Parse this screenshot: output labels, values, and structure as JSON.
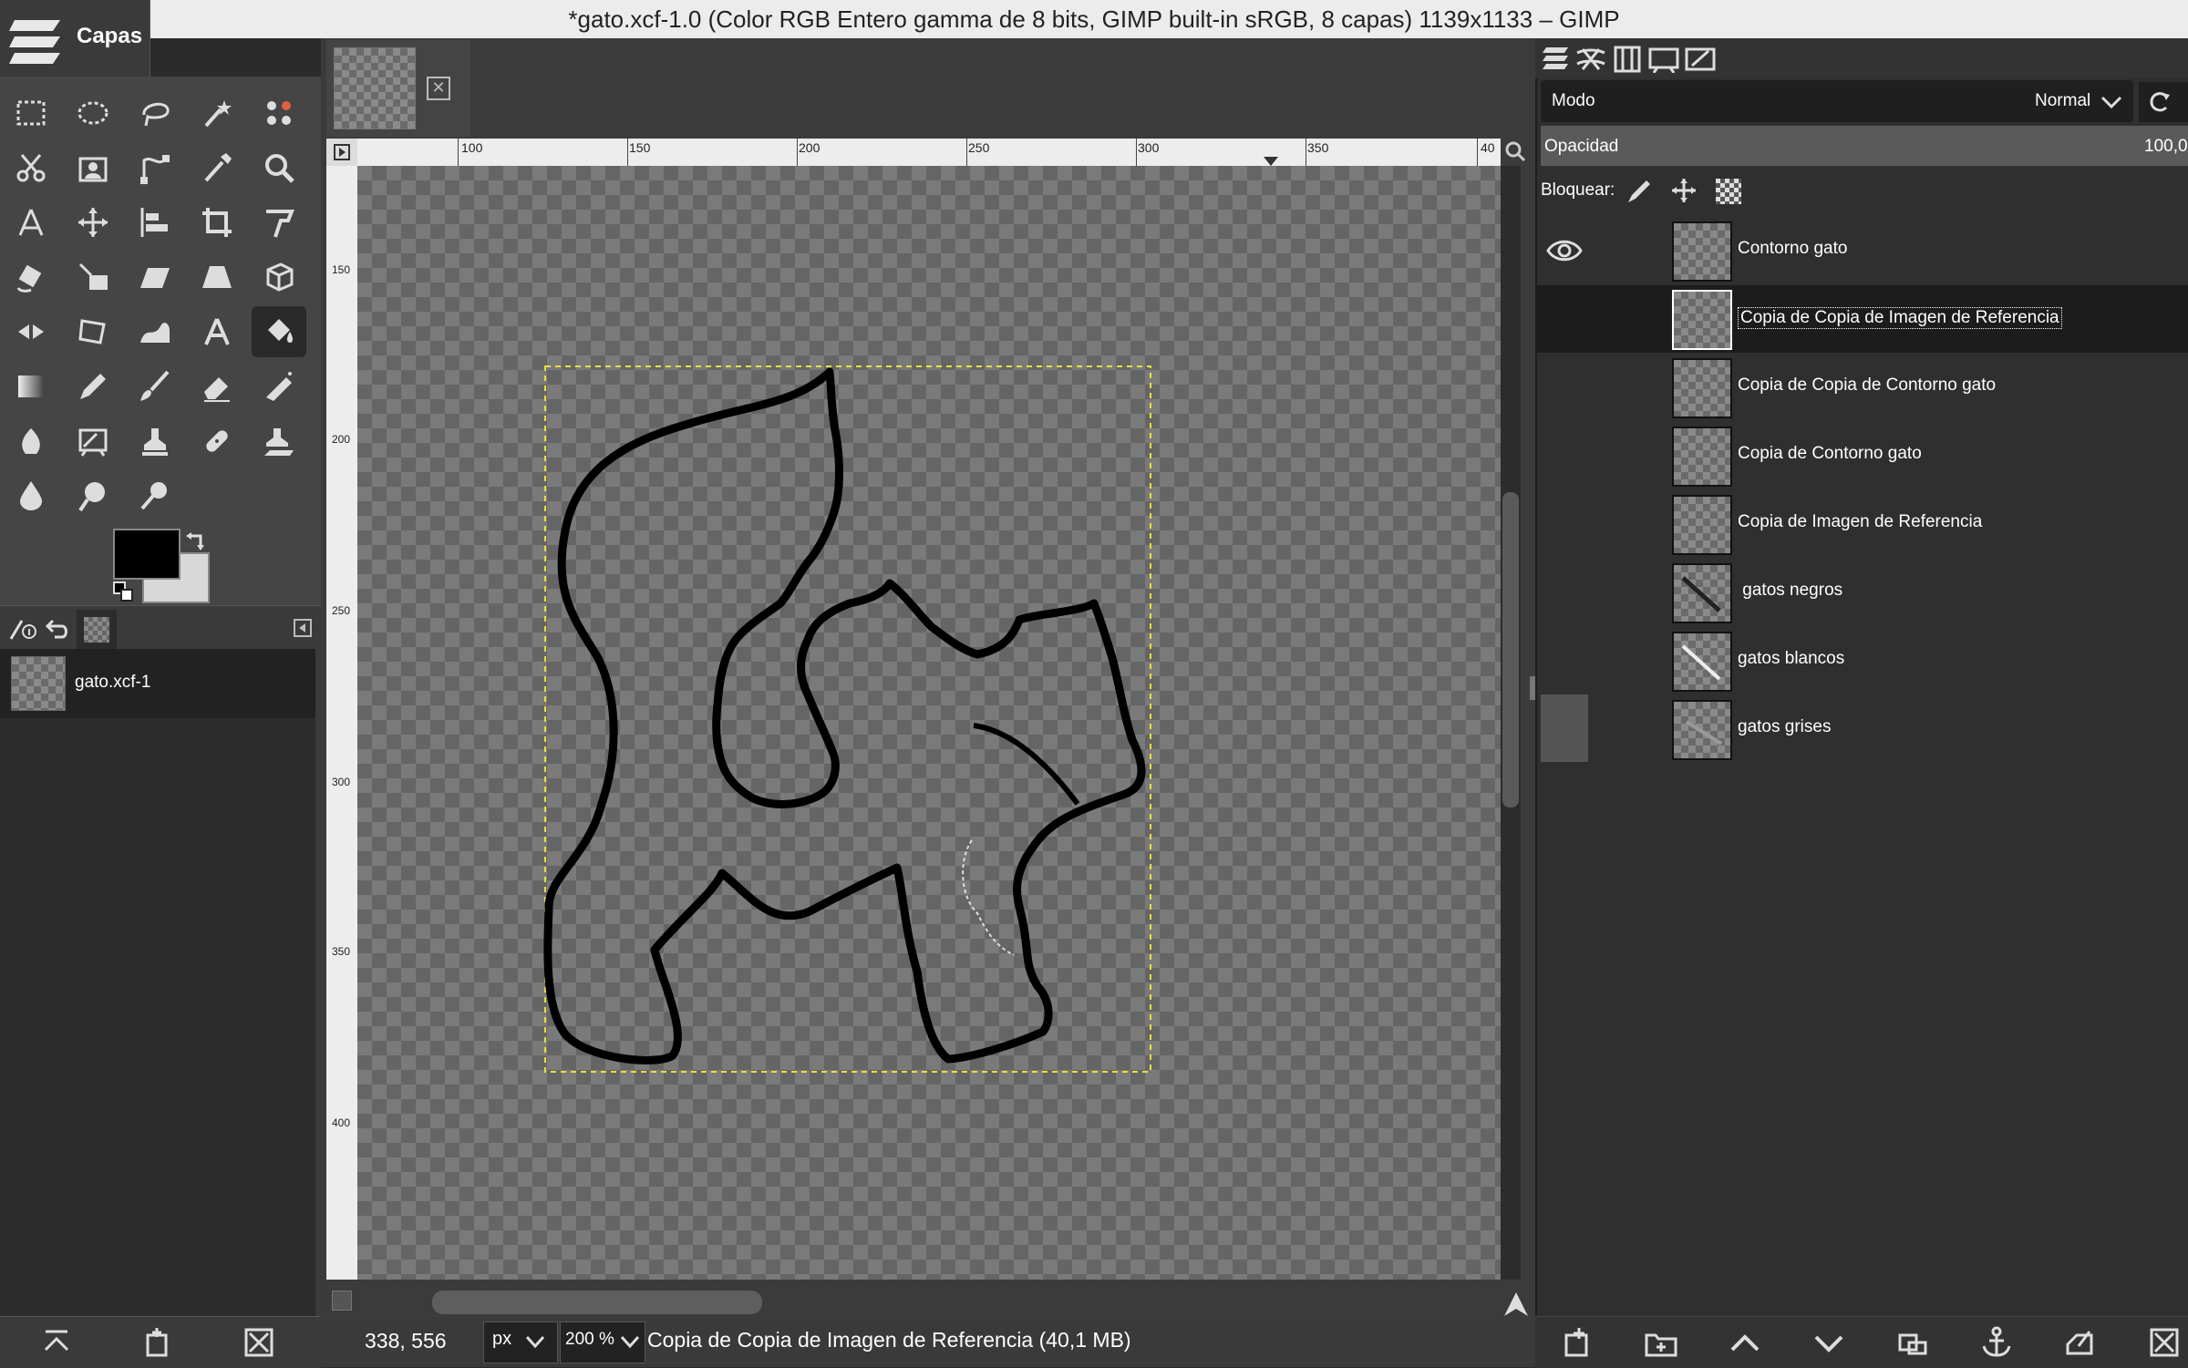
{
  "window": {
    "title": "*gato.xcf-1.0 (Color RGB Entero gamma de 8 bits, GIMP built-in sRGB, 8 capas) 1139x1133 – GIMP",
    "app_menu_label": "Capas"
  },
  "toolbox": {
    "tools": [
      "rect-select-icon",
      "ellipse-select-icon",
      "free-select-icon",
      "fuzzy-select-icon",
      "color-select-icon",
      "scissors-icon",
      "foreground-select-icon",
      "paths-icon",
      "color-picker-icon",
      "zoom-icon",
      "measure-icon",
      "move-icon",
      "align-icon",
      "crop-icon",
      "unified-transform-icon",
      "rotate-icon",
      "scale-icon",
      "shear-icon",
      "perspective-icon",
      "3d-transform-icon",
      "flip-icon",
      "cage-icon",
      "warp-icon",
      "text-icon",
      "bucket-fill-icon",
      "gradient-icon",
      "pencil-icon",
      "paintbrush-icon",
      "eraser-icon",
      "airbrush-icon",
      "ink-icon",
      "mypaint-icon",
      "clone-icon",
      "heal-icon",
      "perspective-clone-icon",
      "blur-icon",
      "smudge-icon",
      "dodge-burn-icon"
    ],
    "active_tool": "bucket-fill-icon",
    "foreground_color": "#000000",
    "background_color": "#d8d8d8"
  },
  "images_dock": {
    "items": [
      {
        "label": "gato.xcf-1"
      }
    ]
  },
  "rulers": {
    "horizontal_labels": [
      "100",
      "150",
      "200",
      "250",
      "300",
      "350",
      "40"
    ],
    "vertical_labels": [
      "150",
      "200",
      "250",
      "300",
      "350",
      "400"
    ]
  },
  "statusbar": {
    "coords": "338, 556",
    "unit": "px",
    "zoom": "200 %",
    "message": "Copia de Copia de Imagen de Referencia (40,1 MB)"
  },
  "layers_panel": {
    "mode_label": "Modo",
    "mode_value": "Normal",
    "opacity_label": "Opacidad",
    "opacity_value": "100,0",
    "lock_label": "Bloquear:",
    "layers": [
      {
        "name": "Contorno gato",
        "visible": true,
        "selected": false
      },
      {
        "name": "Copia de Copia de Imagen de Referencia",
        "visible": false,
        "selected": true
      },
      {
        "name": "Copia de Copia de Contorno gato",
        "visible": false,
        "selected": false
      },
      {
        "name": "Copia de Contorno gato",
        "visible": false,
        "selected": false
      },
      {
        "name": "Copia de Imagen de Referencia",
        "visible": false,
        "selected": false
      },
      {
        "name": " gatos negros",
        "visible": false,
        "selected": false
      },
      {
        "name": "gatos blancos",
        "visible": false,
        "selected": false
      },
      {
        "name": "gatos grises",
        "visible": false,
        "selected": false
      }
    ]
  }
}
